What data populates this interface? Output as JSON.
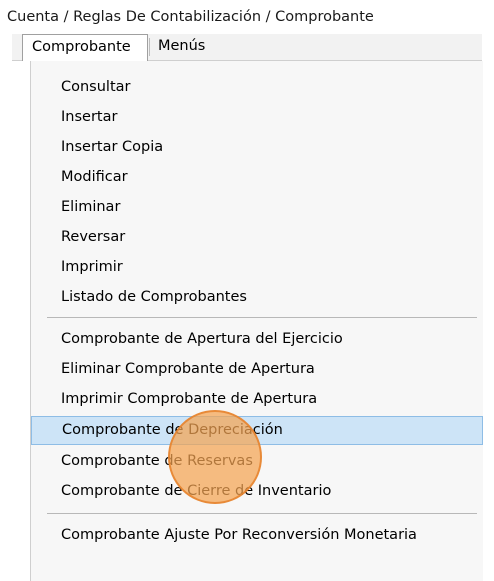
{
  "breadcrumb": "Cuenta / Reglas De Contabilización / Comprobante",
  "menubar": {
    "items": [
      {
        "label": "Comprobante",
        "active": true
      },
      {
        "label": "Menús",
        "active": false
      }
    ]
  },
  "dropdown": {
    "groups": [
      [
        {
          "label": "Consultar"
        },
        {
          "label": "Insertar"
        },
        {
          "label": "Insertar Copia"
        },
        {
          "label": "Modificar"
        },
        {
          "label": "Eliminar"
        },
        {
          "label": "Reversar"
        },
        {
          "label": "Imprimir"
        },
        {
          "label": "Listado de Comprobantes"
        }
      ],
      [
        {
          "label": "Comprobante de Apertura del Ejercicio"
        },
        {
          "label": "Eliminar Comprobante de Apertura"
        },
        {
          "label": "Imprimir Comprobante de Apertura"
        },
        {
          "label": "Comprobante de Depreciación",
          "highlighted": true
        },
        {
          "label": "Comprobante de Reservas"
        },
        {
          "label": "Comprobante de Cierre de Inventario"
        }
      ],
      [
        {
          "label": "Comprobante Ajuste Por Reconversión Monetaria"
        }
      ]
    ]
  },
  "colors": {
    "highlight_bg": "#cde4f7",
    "highlight_border": "#8ebde6",
    "click_indicator": "#f4a452"
  }
}
